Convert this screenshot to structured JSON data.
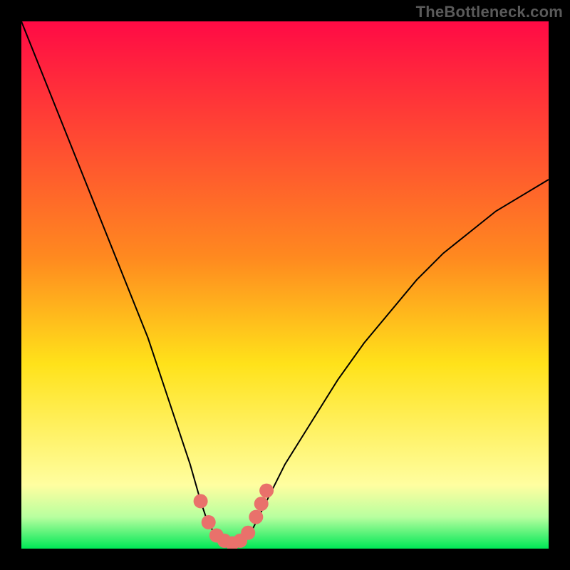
{
  "watermark": "TheBottleneck.com",
  "chart_data": {
    "type": "line",
    "title": "",
    "xlabel": "",
    "ylabel": "",
    "xlim": [
      0,
      100
    ],
    "ylim": [
      0,
      100
    ],
    "grid": false,
    "legend": false,
    "gradient_stops": [
      {
        "y": 100,
        "color": "#ff0a45"
      },
      {
        "y": 55,
        "color": "#ff8a1f"
      },
      {
        "y": 35,
        "color": "#ffe21a"
      },
      {
        "y": 12,
        "color": "#fffea0"
      },
      {
        "y": 6,
        "color": "#b8ff9f"
      },
      {
        "y": 0,
        "color": "#00e756"
      }
    ],
    "series": [
      {
        "name": "bottleneck-curve",
        "color": "#000000",
        "stroke_width": 2,
        "x": [
          0,
          4,
          8,
          12,
          16,
          20,
          24,
          28,
          30,
          32,
          34,
          35,
          36,
          37,
          38,
          39,
          40,
          41,
          42,
          43,
          44,
          46,
          50,
          55,
          60,
          65,
          70,
          75,
          80,
          85,
          90,
          95,
          100
        ],
        "y": [
          100,
          90,
          80,
          70,
          60,
          50,
          40,
          28,
          22,
          16,
          9,
          6,
          4,
          2,
          1.5,
          1.2,
          1,
          1.2,
          1.5,
          2,
          4,
          8,
          16,
          24,
          32,
          39,
          45,
          51,
          56,
          60,
          64,
          67,
          70
        ]
      }
    ],
    "markers": {
      "name": "red-dots",
      "color": "#e9716b",
      "radius": 10,
      "points": [
        {
          "x": 34.0,
          "y": 9.0
        },
        {
          "x": 35.5,
          "y": 5.0
        },
        {
          "x": 37.0,
          "y": 2.5
        },
        {
          "x": 38.5,
          "y": 1.5
        },
        {
          "x": 40.0,
          "y": 1.0
        },
        {
          "x": 41.5,
          "y": 1.5
        },
        {
          "x": 43.0,
          "y": 3.0
        },
        {
          "x": 44.5,
          "y": 6.0
        },
        {
          "x": 45.5,
          "y": 8.5
        },
        {
          "x": 46.5,
          "y": 11.0
        }
      ]
    }
  }
}
